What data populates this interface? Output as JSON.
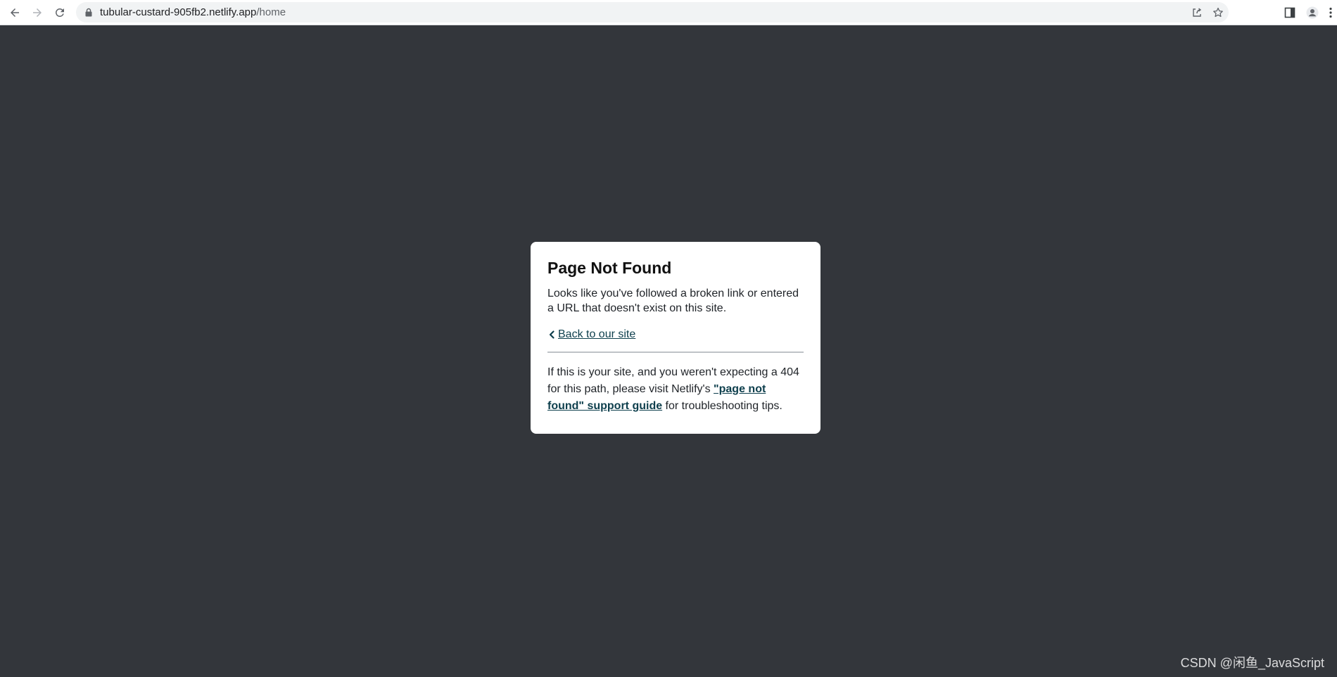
{
  "browser": {
    "url_host": "tubular-custard-905fb2.netlify.app",
    "url_path": "/home",
    "icons": {
      "back": "arrow-left-icon",
      "forward": "arrow-right-icon",
      "reload": "reload-icon",
      "lock": "lock-icon",
      "share": "share-icon",
      "bookmark": "star-icon",
      "side_panel": "side-panel-icon",
      "profile": "profile-icon",
      "menu": "kebab-menu-icon"
    }
  },
  "page": {
    "background_color": "#33363b",
    "card": {
      "title": "Page Not Found",
      "lead_text": "Looks like you've followed a broken link or entered a URL that doesn't exist on this site.",
      "back_link_label": " Back to our site",
      "support_text_before": "If this is your site, and you weren't expecting a 404 for this path, please visit Netlify's ",
      "support_link_label": "\"page not found\" support guide",
      "support_text_after": " for troubleshooting tips.",
      "link_color": "#0e3f4d"
    }
  },
  "watermark": "CSDN @闲鱼_JavaScript"
}
